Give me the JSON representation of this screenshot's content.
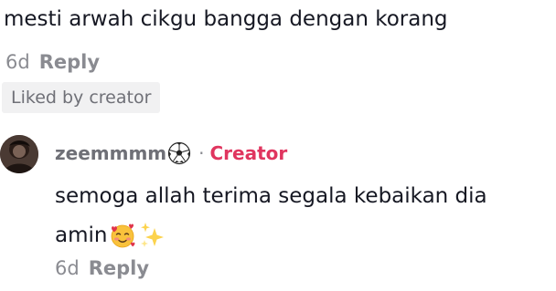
{
  "parent_comment": {
    "text": "mesti arwah cikgu bangga dengan korang",
    "time": "6d",
    "reply_label": "Reply",
    "liked_badge": "Liked by creator"
  },
  "reply_comment": {
    "avatar_icon": "user-avatar",
    "username": "zeemmmm",
    "username_icon": "soccer-ball-icon",
    "separator": "·",
    "creator_label": "Creator",
    "text_line1": "semoga allah terima segala kebaikan dia",
    "text_line2": "amin",
    "text_line2_icons": [
      "smiling-face-with-hearts-icon",
      "sparkles-icon"
    ],
    "time": "6d",
    "reply_label": "Reply"
  },
  "colors": {
    "text_primary": "#161823",
    "text_secondary": "#8a8b91",
    "creator_accent": "#e0355f",
    "badge_bg": "#f1f1f2"
  }
}
